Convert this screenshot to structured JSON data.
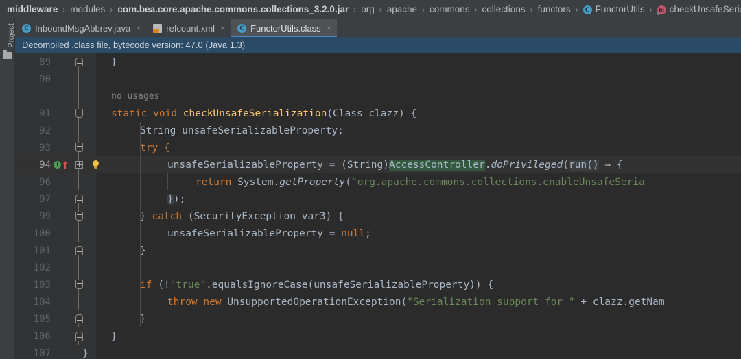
{
  "window": {
    "theme_bg": "#2b2b2b",
    "accent": "#4a88c7"
  },
  "breadcrumb": {
    "items": [
      {
        "label": "middleware",
        "bold": true,
        "icon": ""
      },
      {
        "label": "modules",
        "bold": false,
        "icon": ""
      },
      {
        "label": "com.bea.core.apache.commons.collections_3.2.0.jar",
        "bold": true,
        "icon": ""
      },
      {
        "label": "org",
        "bold": false,
        "icon": ""
      },
      {
        "label": "apache",
        "bold": false,
        "icon": ""
      },
      {
        "label": "commons",
        "bold": false,
        "icon": ""
      },
      {
        "label": "collections",
        "bold": false,
        "icon": ""
      },
      {
        "label": "functors",
        "bold": false,
        "icon": ""
      },
      {
        "label": "FunctorUtils",
        "bold": false,
        "icon": "class-icon"
      },
      {
        "label": "checkUnsafeSerialization",
        "bold": false,
        "icon": "method-icon"
      }
    ],
    "separator": "›"
  },
  "toolstrip": {
    "project_label": "Project",
    "folder_icon": "folder-icon"
  },
  "tabs": [
    {
      "label": "InboundMsgAbbrev.java",
      "icon": "java-class-icon",
      "active": false,
      "close": "×"
    },
    {
      "label": "refcount.xml",
      "icon": "xml-file-icon",
      "active": false,
      "close": "×"
    },
    {
      "label": "FunctorUtils.class",
      "icon": "java-class-icon",
      "active": true,
      "close": "×"
    }
  ],
  "notification": {
    "text": "Decompiled .class file, bytecode version: 47.0 (Java 1.3)"
  },
  "editor": {
    "gutter": {
      "icons": {
        "run_marker": "I",
        "implements_arrow": "implements-arrow-icon",
        "intention_bulb": "lightbulb-icon"
      }
    },
    "inlay_hints": {
      "no_usages": "no usages",
      "run_param": "run()"
    },
    "lines": [
      {
        "num": "89",
        "fold": "cap-up"
      },
      {
        "num": "90",
        "fold": ""
      },
      {
        "num": "",
        "fold": ""
      },
      {
        "num": "91",
        "fold": "cap-down"
      },
      {
        "num": "92",
        "fold": ""
      },
      {
        "num": "93",
        "fold": "cap-down"
      },
      {
        "num": "94",
        "fold": "box-plus",
        "current": true
      },
      {
        "num": "96",
        "fold": ""
      },
      {
        "num": "97",
        "fold": "cap-up"
      },
      {
        "num": "99",
        "fold": "cap-down"
      },
      {
        "num": "100",
        "fold": ""
      },
      {
        "num": "101",
        "fold": "cap-up"
      },
      {
        "num": "102",
        "fold": ""
      },
      {
        "num": "103",
        "fold": "cap-down"
      },
      {
        "num": "104",
        "fold": ""
      },
      {
        "num": "105",
        "fold": "cap-up"
      },
      {
        "num": "106",
        "fold": "cap-up"
      },
      {
        "num": "107",
        "fold": ""
      }
    ],
    "code": {
      "l89": "}",
      "l90": "",
      "l_usages": "no usages",
      "l91_a": "static",
      "l91_b": "void",
      "l91_c": "checkUnsafeSerialization",
      "l91_d": "(Class clazz) {",
      "l92": "String unsafeSerializableProperty;",
      "l93": "try {",
      "l94_a": "unsafeSerializableProperty = (String)",
      "l94_b": "AccessController",
      "l94_c": ".",
      "l94_d": "doPrivileged",
      "l94_e": "(",
      "l94_f": "run()",
      "l94_g": " → {",
      "l96_a": "return",
      "l96_b": " System.",
      "l96_c": "getProperty",
      "l96_d": "(",
      "l96_e": "\"org.apache.commons.collections.enableUnsafeSeria",
      "l97_a": "}",
      "l97_b": ");",
      "l99_a": "} ",
      "l99_b": "catch",
      "l99_c": " (SecurityException var3) {",
      "l100_a": "unsafeSerializableProperty = ",
      "l100_b": "null",
      "l100_c": ";",
      "l101": "}",
      "l102": "",
      "l103_a": "if",
      "l103_b": " (!",
      "l103_c": "\"true\"",
      "l103_d": ".equalsIgnoreCase(unsafeSerializableProperty)) {",
      "l104_a": "throw",
      "l104_b": " ",
      "l104_c": "new",
      "l104_d": " UnsupportedOperationException(",
      "l104_e": "\"Serialization support for \"",
      "l104_f": " + clazz.getNam",
      "l105": "}",
      "l106": "}",
      "l107": "}"
    }
  }
}
